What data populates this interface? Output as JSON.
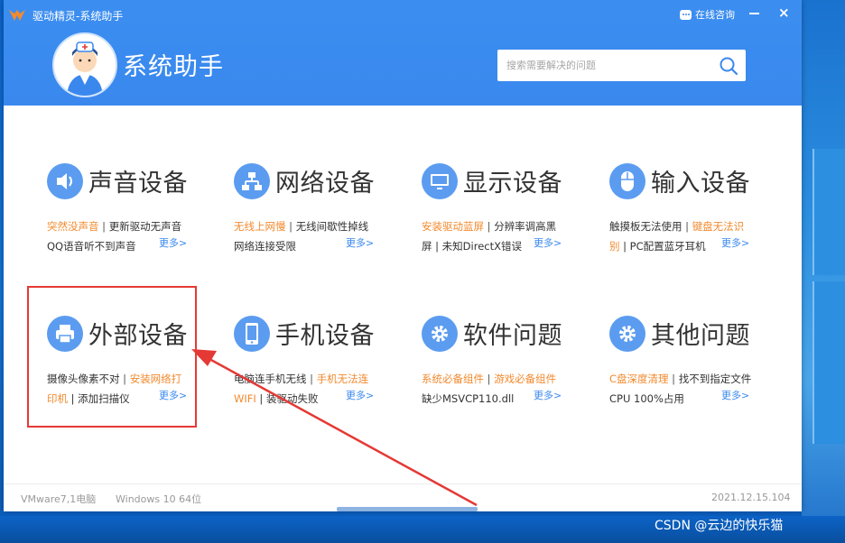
{
  "titlebar": {
    "title": "驱动精灵-系统助手",
    "consult_label": "在线咨询",
    "minimize_label": "",
    "close_glyph": "×"
  },
  "header": {
    "app_title": "系统助手",
    "search_placeholder": "搜索需要解决的问题"
  },
  "categories": [
    {
      "title": "声音设备",
      "icon": "speaker-icon",
      "line1_a": "突然没声音",
      "line1_b": " | ",
      "line1_c": "更新驱动无声音",
      "line2": "QQ语音听不到声音",
      "more": "更多>"
    },
    {
      "title": "网络设备",
      "icon": "network-icon",
      "line1_a": "无线上网慢",
      "line1_b": " | ",
      "line1_c": "无线间歇性掉线",
      "line2": "网络连接受限",
      "more": "更多>"
    },
    {
      "title": "显示设备",
      "icon": "monitor-icon",
      "line1_a": "安装驱动蓝屏",
      "line1_b": " | ",
      "line1_c": "分辨率调高黑",
      "line2": "屏 | 未知DirectX错误",
      "more": "更多>"
    },
    {
      "title": "输入设备",
      "icon": "mouse-icon",
      "line1_a": "触摸板无法使用",
      "line1_b": " | ",
      "line1_c": "键盘无法识",
      "line2_a": "别",
      "line2_b": " | PC配置蓝牙耳机",
      "more": "更多>"
    },
    {
      "title": "外部设备",
      "icon": "printer-icon",
      "line1_a": "摄像头像素不对",
      "line1_b": " | ",
      "line1_c": "安装网络打",
      "line2_a": "印机",
      "line2_b": " | 添加扫描仪",
      "more": "更多>"
    },
    {
      "title": "手机设备",
      "icon": "phone-icon",
      "line1_a": "电脑连手机无线",
      "line1_b": " | ",
      "line1_c": "手机无法连",
      "line2_a": "WIFI",
      "line2_b": " | 装驱动失败",
      "more": "更多>"
    },
    {
      "title": "软件问题",
      "icon": "gear-icon",
      "line1_a": "系统必备组件",
      "line1_b": " | ",
      "line1_c": "游戏必备组件",
      "line2": "缺少MSVCP110.dll",
      "more": "更多>"
    },
    {
      "title": "其他问题",
      "icon": "gear-icon",
      "line1_a": "C盘深度清理",
      "line1_b": " | ",
      "line1_c": "找不到指定文件",
      "line2": "CPU 100%占用",
      "more": "更多>"
    }
  ],
  "status": {
    "pc": "VMware7,1电脑",
    "os": "Windows 10 64位",
    "version": "2021.12.15.104"
  },
  "watermark": "CSDN @云边的快乐猫",
  "colors": {
    "header": "#3a88ee",
    "accent_orange": "#f28a2e",
    "link_blue": "#3a88ee",
    "highlight_red": "#e53935"
  }
}
